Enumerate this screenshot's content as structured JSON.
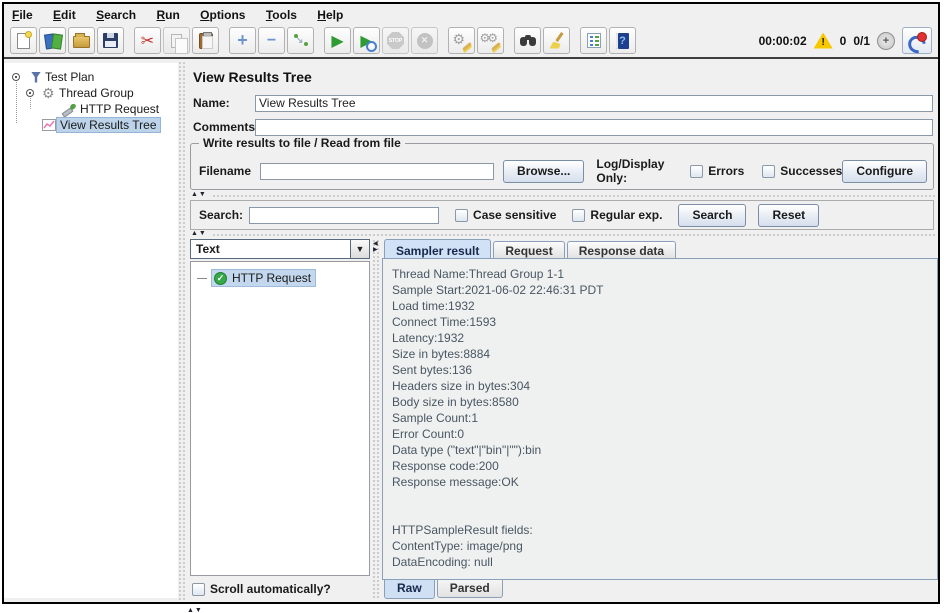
{
  "colors": {
    "selection": "#bdd3ea",
    "tab_active": "#d2e2f6",
    "success_green": "#35a847",
    "warning_yellow": "#f7c700",
    "accent_border": "#8aa0b8"
  },
  "menubar": {
    "items": [
      {
        "label": "File"
      },
      {
        "label": "Edit"
      },
      {
        "label": "Search"
      },
      {
        "label": "Run"
      },
      {
        "label": "Options"
      },
      {
        "label": "Tools"
      },
      {
        "label": "Help"
      }
    ]
  },
  "toolbar": {
    "icons": [
      "new-file",
      "open-template",
      "open-file",
      "save",
      "cut",
      "copy",
      "paste",
      "expand-all",
      "collapse-all",
      "toggle",
      "start",
      "start-no-timers",
      "stop",
      "shutdown",
      "clear",
      "clear-all",
      "search",
      "clear-search",
      "function-helper",
      "help",
      "warning",
      "thread-status",
      "remote"
    ],
    "stop_label": "STOP",
    "status": {
      "timer": "00:00:02",
      "warning_count": "0",
      "threads": "0/1"
    }
  },
  "sidebar": {
    "items": [
      {
        "label": "Test Plan"
      },
      {
        "label": "Thread Group"
      },
      {
        "label": "HTTP Request"
      },
      {
        "label": "View Results Tree"
      }
    ]
  },
  "main": {
    "title": "View Results Tree",
    "name_label": "Name:",
    "name_value": "View Results Tree",
    "comments_label": "Comments:",
    "comments_value": "",
    "file_group": {
      "legend": "Write results to file / Read from file",
      "filename_label": "Filename",
      "filename_value": "",
      "browse": "Browse...",
      "log_display": "Log/Display Only:",
      "errors": "Errors",
      "successes": "Successes",
      "configure": "Configure"
    },
    "search": {
      "label": "Search:",
      "value": "",
      "case_sensitive": "Case sensitive",
      "regular_exp": "Regular exp.",
      "search_btn": "Search",
      "reset_btn": "Reset"
    },
    "results": {
      "view_mode": "Text",
      "tree_items": [
        {
          "label": "HTTP Request"
        }
      ],
      "scroll_label": "Scroll automatically?",
      "tabs": [
        {
          "label": "Sampler result"
        },
        {
          "label": "Request"
        },
        {
          "label": "Response data"
        }
      ],
      "sampler_text": "Thread Name:Thread Group 1-1\nSample Start:2021-06-02 22:46:31 PDT\nLoad time:1932\nConnect Time:1593\nLatency:1932\nSize in bytes:8884\nSent bytes:136\nHeaders size in bytes:304\nBody size in bytes:8580\nSample Count:1\nError Count:0\nData type (\"text\"|\"bin\"|\"\"):bin\nResponse code:200\nResponse message:OK\n\n\nHTTPSampleResult fields:\nContentType: image/png\nDataEncoding: null",
      "bottom_tabs": [
        {
          "label": "Raw"
        },
        {
          "label": "Parsed"
        }
      ]
    }
  }
}
